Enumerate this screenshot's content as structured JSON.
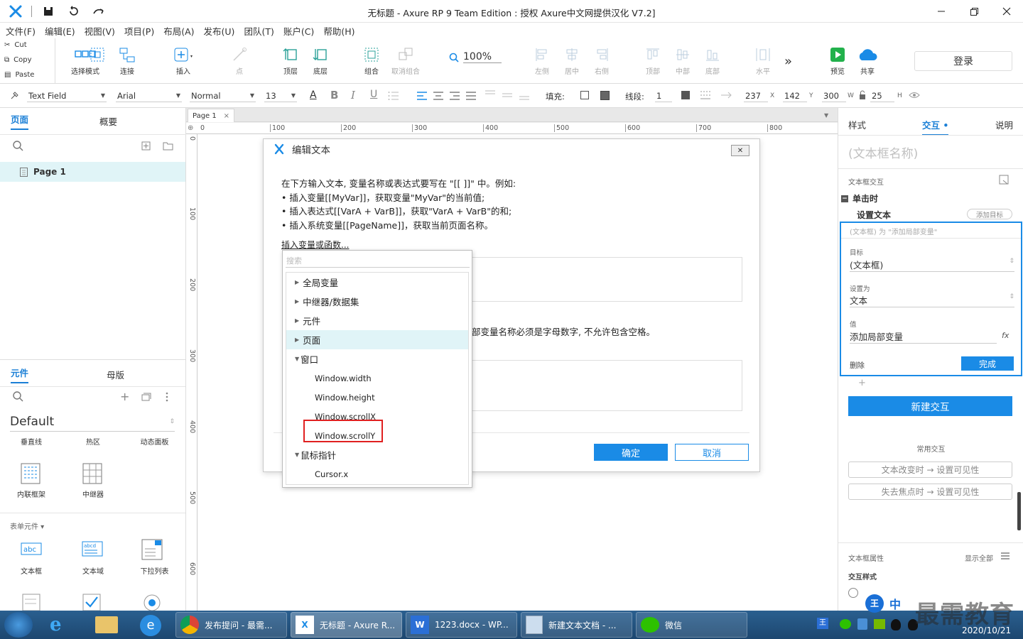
{
  "title_bar": {
    "title": "无标题 - Axure RP 9 Team Edition : 授权 Axure中文网提供汉化 V7.2]"
  },
  "menu": [
    "文件(F)",
    "编辑(E)",
    "视图(V)",
    "项目(P)",
    "布局(A)",
    "发布(U)",
    "团队(T)",
    "账户(C)",
    "帮助(H)"
  ],
  "clipboard": {
    "cut": "Cut",
    "copy": "Copy",
    "paste": "Paste"
  },
  "toolbar": {
    "select_mode": "选择模式",
    "connect": "连接",
    "insert": "插入",
    "point": "点",
    "top_layer": "顶层",
    "bottom_layer": "底层",
    "group": "组合",
    "ungroup": "取消组合",
    "zoom": "100%",
    "align_left": "左侧",
    "align_center": "居中",
    "align_right": "右侧",
    "align_top": "顶部",
    "align_middle": "中部",
    "align_bottom": "底部",
    "distribute_h": "水平",
    "preview": "预览",
    "share": "共享",
    "login": "登录"
  },
  "format": {
    "style": "Text Field",
    "font": "Arial",
    "weight": "Normal",
    "size": "13",
    "fill_label": "填充:",
    "stroke_label": "线段:",
    "stroke_value": "1",
    "x": "237",
    "x_label": "X",
    "y": "142",
    "y_label": "Y",
    "w": "300",
    "w_label": "W",
    "h": "25",
    "h_label": "H"
  },
  "left": {
    "tab_pages": "页面",
    "tab_outline": "概要",
    "page_item": "Page 1",
    "tab_widgets": "元件",
    "tab_masters": "母版",
    "library": "Default",
    "widgets_row1": [
      "垂直线",
      "热区",
      "动态面板"
    ],
    "widgets_row2": [
      "内联框架",
      "中继器"
    ],
    "form_section": "表单元件",
    "widgets_row3": [
      "文本框",
      "文本域",
      "下拉列表"
    ]
  },
  "canvas": {
    "tab": "Page 1",
    "ruler_h": [
      "0",
      "100",
      "200",
      "300",
      "400",
      "500",
      "600",
      "700",
      "800"
    ],
    "ruler_v": [
      "0",
      "100",
      "200",
      "300",
      "400",
      "500",
      "600"
    ]
  },
  "dialog": {
    "title": "编辑文本",
    "intro": "在下方输入文本, 变量名称或表达式要写在 \"[[ ]]\" 中。例如:",
    "bullets": [
      "插入变量[[MyVar]]，获取变量\"MyVar\"的当前值;",
      "插入表达式[[VarA + VarB]]，获取\"VarA + VarB\"的和;",
      "插入系统变量[[PageName]]，获取当前页面名称。"
    ],
    "insert_link": "插入变量或函数...",
    "local_var_note": "部变量名称必须是字母数字, 不允许包含空格。",
    "ok": "确定",
    "cancel": "取消"
  },
  "dropdown": {
    "search_placeholder": "搜索",
    "groups": [
      "全局变量",
      "中继器/数据集",
      "元件",
      "页面"
    ],
    "window_group": "窗口",
    "window_items": [
      "Window.width",
      "Window.height",
      "Window.scrollX",
      "Window.scrollY"
    ],
    "cursor_group": "鼠标指针",
    "cursor_items": [
      "Cursor.x"
    ]
  },
  "right": {
    "tab_style": "样式",
    "tab_interact": "交互",
    "tab_notes": "说明",
    "widget_name": "(文本框名称)",
    "interactions_label": "文本框交互",
    "event": "单击时",
    "action": "设置文本",
    "add_target": "添加目标",
    "summary": "(文本框) 为 \"添加局部变量\"",
    "target_label": "目标",
    "target_value": "(文本框)",
    "set_as_label": "设置为",
    "set_as_value": "文本",
    "value_label": "值",
    "value_value": "添加局部变量",
    "fx": "fx",
    "delete": "删除",
    "done": "完成",
    "new_interaction": "新建交互",
    "common_label": "常用交互",
    "common_items": [
      "文本改变时 → 设置可见性",
      "失去焦点时 → 设置可见性"
    ],
    "props_label": "文本框属性",
    "show_all": "显示全部",
    "interaction_style": "交互样式"
  },
  "taskbar": {
    "tasks": [
      "发布提问 - 最需...",
      "无标题 - Axure R...",
      "1223.docx - WP...",
      "新建文本文档 - ...",
      "微信"
    ],
    "ime": "中",
    "date": "2020/10/21",
    "watermark": "最需教育"
  },
  "colors": {
    "accent": "#1a8be6",
    "highlight_red": "#e02020",
    "selected_row": "#e0f4f7"
  }
}
